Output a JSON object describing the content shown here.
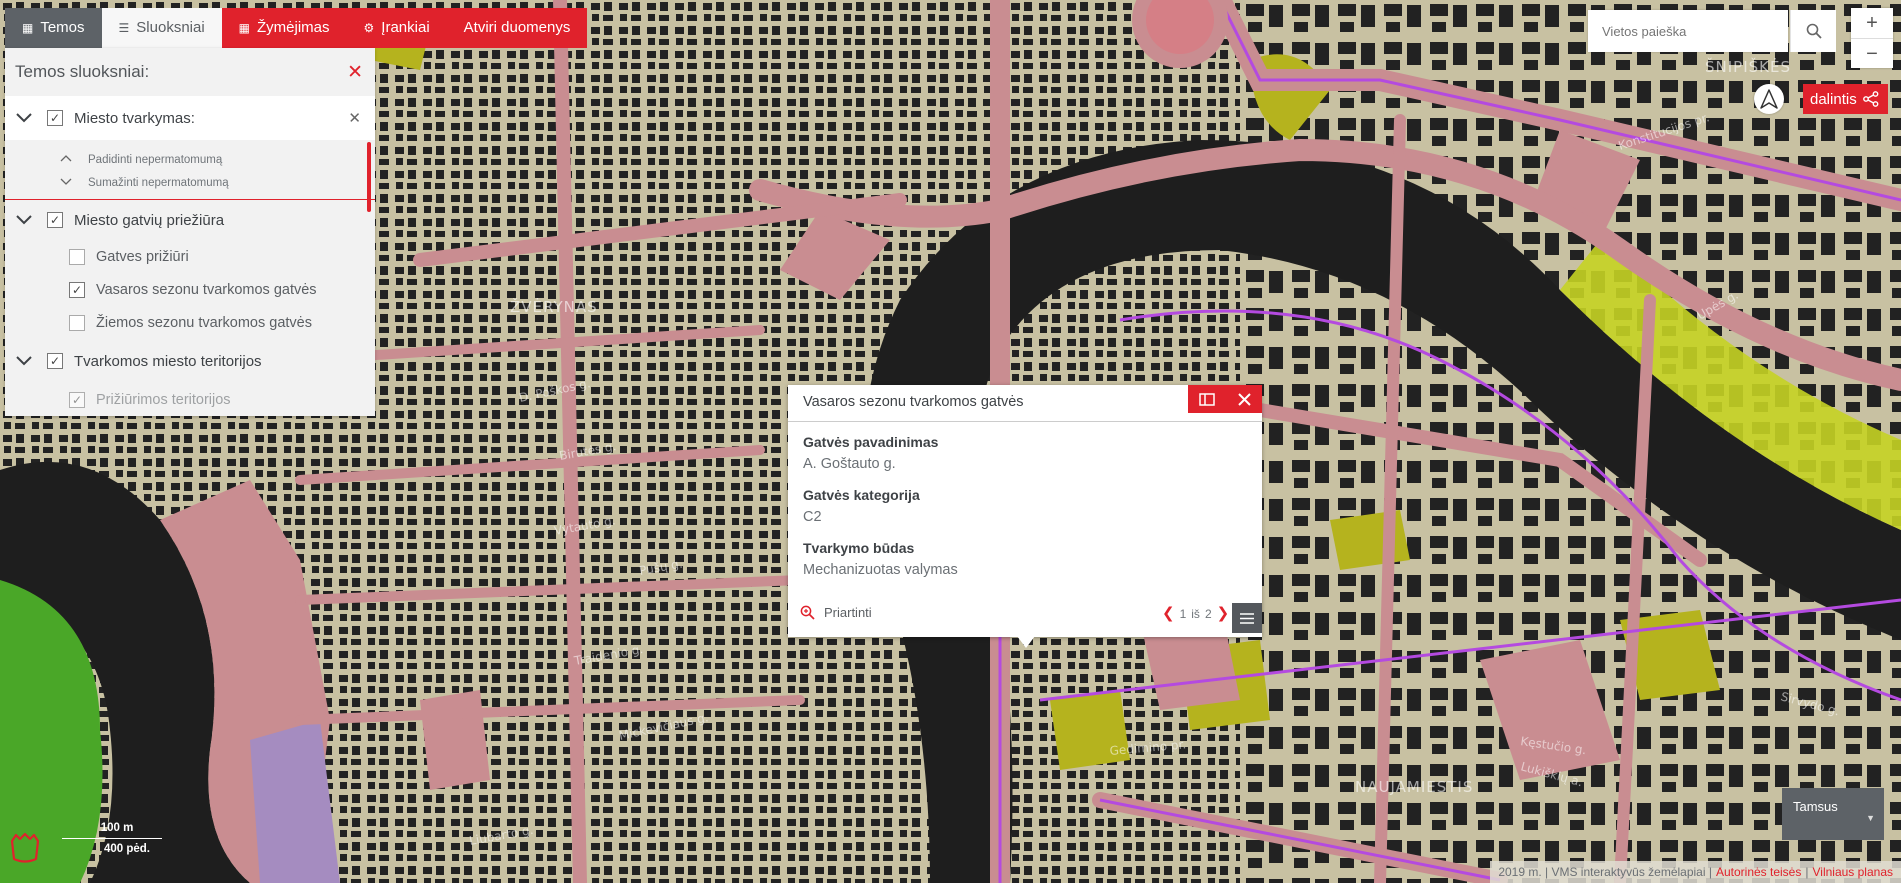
{
  "tabs": [
    {
      "label": "Temos",
      "icon": "grid-icon",
      "state": "dark"
    },
    {
      "label": "Sluoksniai",
      "icon": "list-icon",
      "state": "active"
    },
    {
      "label": "Žymėjimas",
      "icon": "grid-icon",
      "state": "red"
    },
    {
      "label": "Įrankiai",
      "icon": "gear-icon",
      "state": "red"
    },
    {
      "label": "Atviri duomenys",
      "icon": "",
      "state": "red"
    }
  ],
  "panel": {
    "title": "Temos sluoksniai:",
    "groups": [
      {
        "label": "Miesto tvarkymas:",
        "checked": true,
        "options": [
          "Padidinti nepermatomumą",
          "Sumažinti nepermatomumą"
        ]
      },
      {
        "label": "Miesto gatvių priežiūra",
        "checked": true,
        "items": [
          {
            "label": "Gatves prižiūri",
            "checked": false
          },
          {
            "label": "Vasaros sezonu tvarkomos gatvės",
            "checked": true
          },
          {
            "label": "Žiemos sezonu tvarkomos gatvės",
            "checked": false
          }
        ]
      },
      {
        "label": "Tvarkomos miesto teritorijos",
        "checked": true,
        "items": [
          {
            "label": "Prižiūrimos teritorijos",
            "checked": true
          }
        ]
      }
    ]
  },
  "search": {
    "placeholder": "Vietos paieška",
    "icon": "search-icon"
  },
  "zoom": {
    "in": "+",
    "out": "−"
  },
  "share": {
    "label": "dalintis",
    "icon": "share-icon"
  },
  "popup": {
    "title": "Vasaros sezonu tvarkomos gatvės",
    "fields": [
      {
        "label": "Gatvės pavadinimas",
        "value": "A. Goštauto g."
      },
      {
        "label": "Gatvės kategorija",
        "value": "C2"
      },
      {
        "label": "Tvarkymo būdas",
        "value": "Mechanizuotas valymas"
      }
    ],
    "zoom_label": "Priartinti",
    "pager": {
      "current": "1",
      "of": "iš",
      "total": "2"
    }
  },
  "scale": {
    "metric": "100 m",
    "imperial": "400 pėd."
  },
  "basemap": {
    "label": "Tamsus"
  },
  "attribution": {
    "text": "2019 m. | VMS interaktyvūs žemėlapiai |",
    "link1": "Autorinės teisės",
    "sep": "|",
    "link2": "Vilniaus planas"
  },
  "map_labels": {
    "center_district": "ŠNIPIŠKĖS",
    "south_district": "NAUJAMIESTIS",
    "west_district": "ŽVĖRYNAS",
    "streets": [
      "Konstitucijos pr.",
      "Upės g.",
      "Lukiškių a.",
      "Liubarto g.",
      "Mickevičiaus g.",
      "Traidenio g.",
      "Vytauto g.",
      "Birutės g.",
      "Pušų g.",
      "D. Poškos g.",
      "Sirvydo g.",
      "Kęstučio g.",
      "Gedimino pr."
    ]
  },
  "colors": {
    "accent": "#e0222c",
    "tab_dark": "#5d6267",
    "map_road": "#c98d91",
    "map_block": "#c8c1a2",
    "map_river": "#1e1e1e",
    "map_green": "#4aa728"
  }
}
